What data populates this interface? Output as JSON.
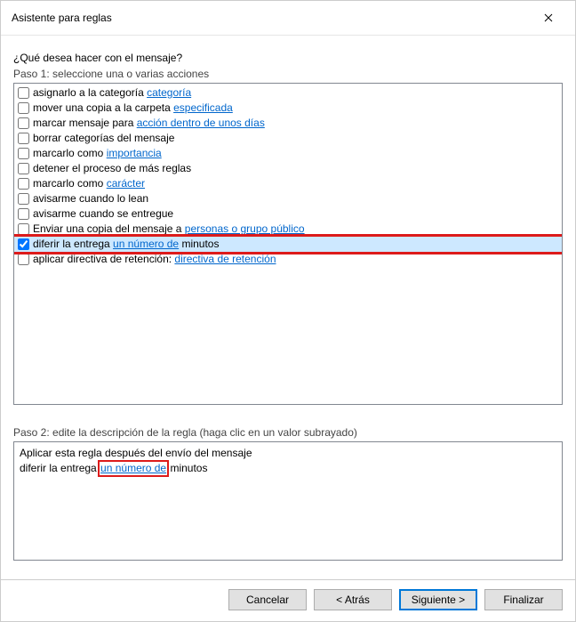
{
  "window": {
    "title": "Asistente para reglas"
  },
  "question": "¿Qué desea hacer con el mensaje?",
  "step1_label": "Paso 1: seleccione una o varias acciones",
  "actions": [
    {
      "checked": false,
      "pre": "asignarlo a la categoría ",
      "link": "categoría",
      "post": ""
    },
    {
      "checked": false,
      "pre": "mover una copia a la carpeta ",
      "link": "especificada",
      "post": ""
    },
    {
      "checked": false,
      "pre": "marcar mensaje para ",
      "link": "acción dentro de unos días",
      "post": ""
    },
    {
      "checked": false,
      "pre": "borrar categorías del mensaje",
      "link": "",
      "post": ""
    },
    {
      "checked": false,
      "pre": "marcarlo como ",
      "link": "importancia",
      "post": ""
    },
    {
      "checked": false,
      "pre": "detener el proceso de más reglas",
      "link": "",
      "post": ""
    },
    {
      "checked": false,
      "pre": "marcarlo como ",
      "link": "carácter",
      "post": ""
    },
    {
      "checked": false,
      "pre": "avisarme cuando lo lean",
      "link": "",
      "post": ""
    },
    {
      "checked": false,
      "pre": "avisarme cuando se entregue",
      "link": "",
      "post": ""
    },
    {
      "checked": false,
      "pre": "Enviar una copia del mensaje a ",
      "link": "personas o grupo público",
      "post": ""
    },
    {
      "checked": true,
      "pre": "diferir la entrega ",
      "link": "un número de",
      "post": " minutos",
      "selected": true
    },
    {
      "checked": false,
      "pre": "aplicar directiva de retención: ",
      "link": "directiva de retención",
      "post": ""
    }
  ],
  "step2_label": "Paso 2: edite la descripción de la regla (haga clic en un valor subrayado)",
  "desc": {
    "line1": "Aplicar esta regla después del envío del mensaje",
    "line2_pre": "diferir la entrega ",
    "line2_link": "un número de",
    "line2_post": " minutos"
  },
  "buttons": {
    "cancel": "Cancelar",
    "back": "< Atrás",
    "next": "Siguiente >",
    "finish": "Finalizar"
  }
}
